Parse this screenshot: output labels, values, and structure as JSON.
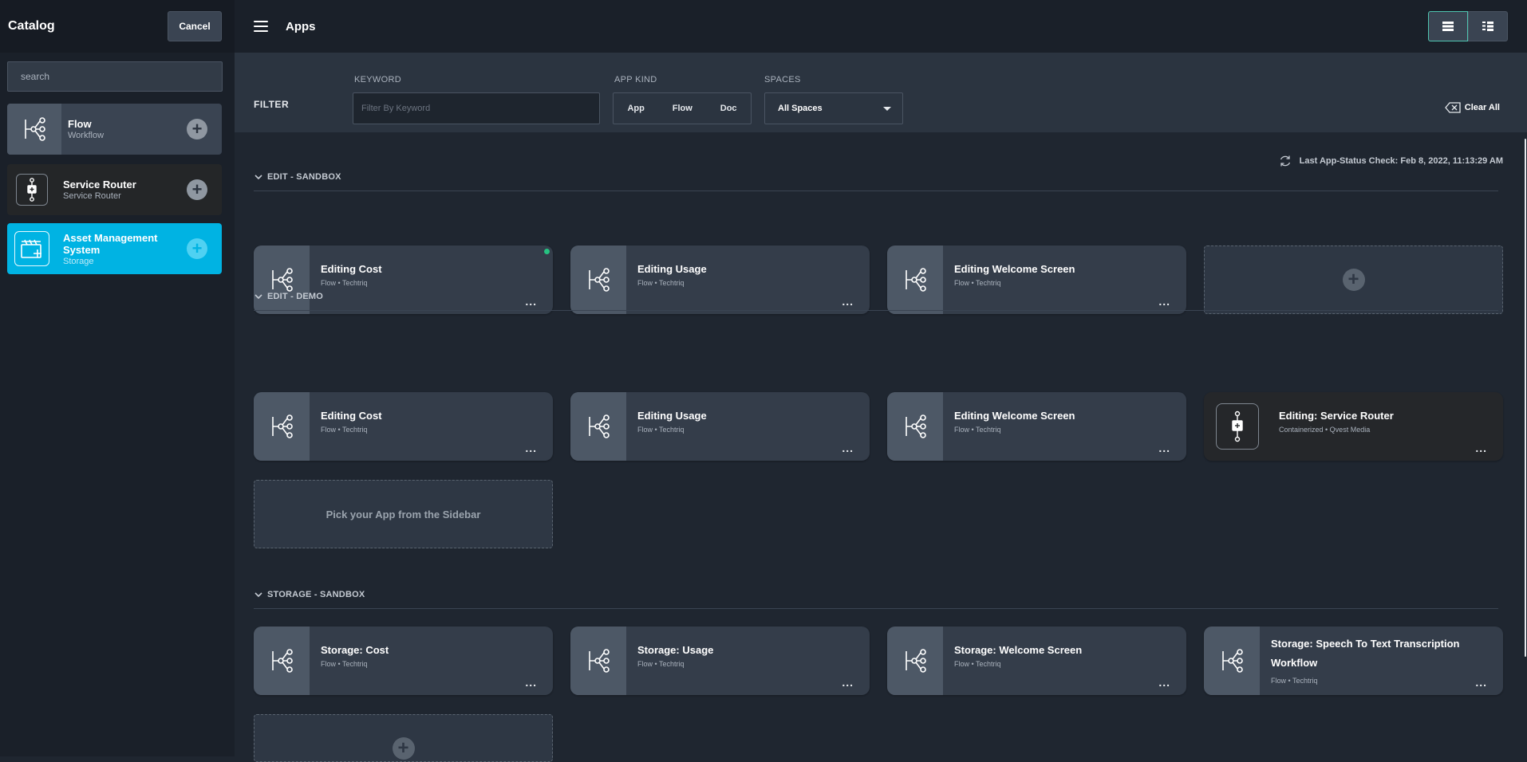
{
  "sidebar": {
    "title": "Catalog",
    "cancel_label": "Cancel",
    "search_placeholder": "search",
    "items": [
      {
        "name": "Flow",
        "sub": "Workflow",
        "icon": "flow-icon"
      },
      {
        "name": "Service Router",
        "sub": "Service Router",
        "icon": "service-router-icon"
      },
      {
        "name": "Asset Management System",
        "sub": "Storage",
        "icon": "asset-storage-icon"
      }
    ]
  },
  "topbar": {
    "title": "Apps",
    "views": [
      "grid-view-icon",
      "list-view-icon"
    ]
  },
  "filter": {
    "label": "FILTER",
    "keyword_label": "KEYWORD",
    "keyword_placeholder": "Filter By Keyword",
    "kind_label": "APP KIND",
    "kinds": [
      "App",
      "Flow",
      "Doc"
    ],
    "spaces_label": "SPACES",
    "spaces_value": "All Spaces",
    "clear_label": "Clear All"
  },
  "status": {
    "text": "Last App-Status Check: Feb 8, 2022, 11:13:29 AM"
  },
  "sections": [
    {
      "title": "EDIT - SANDBOX",
      "cards": [
        {
          "title": "Editing Cost",
          "sub": "Flow • Techtriq",
          "more": "..."
        },
        {
          "title": "Editing Usage",
          "sub": "Flow • Techtriq",
          "more": "..."
        },
        {
          "title": "Editing Welcome Screen",
          "sub": "Flow • Techtriq",
          "more": "..."
        }
      ]
    },
    {
      "title": "EDIT - DEMO",
      "cards": [
        {
          "title": "Editing Cost",
          "sub": "Flow • Techtriq",
          "more": "..."
        },
        {
          "title": "Editing Usage",
          "sub": "Flow • Techtriq",
          "more": "..."
        },
        {
          "title": "Editing Welcome Screen",
          "sub": "Flow • Techtriq",
          "more": "..."
        },
        {
          "title": "Editing: Service Router",
          "sub": "Containerized • Qvest Media",
          "more": "..."
        }
      ],
      "placeholder": "Pick your App from the Sidebar"
    },
    {
      "title": "STORAGE - SANDBOX",
      "cards": [
        {
          "title": "Storage: Cost",
          "sub": "Flow • Techtriq",
          "more": "..."
        },
        {
          "title": "Storage: Usage",
          "sub": "Flow • Techtriq",
          "more": "..."
        },
        {
          "title": "Storage: Welcome Screen",
          "sub": "Flow • Techtriq",
          "more": "..."
        },
        {
          "title": "Storage: Speech To Text Transcription Workflow",
          "sub": "Flow • Techtriq",
          "more": "..."
        }
      ]
    }
  ],
  "colors": {
    "accent": "#00b3e3",
    "status_ok": "#26c281",
    "active_view": "#4fc4b0"
  }
}
